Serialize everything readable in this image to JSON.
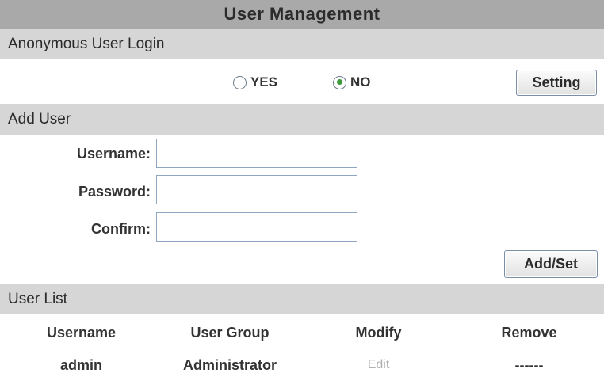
{
  "title": "User Management",
  "sections": {
    "anonymous": "Anonymous User Login",
    "add_user": "Add User",
    "user_list": "User List"
  },
  "anonymous_login": {
    "options": [
      "YES",
      "NO"
    ],
    "selected": "NO",
    "setting_button": "Setting"
  },
  "add_user_form": {
    "username_label": "Username:",
    "password_label": "Password:",
    "confirm_label": "Confirm:",
    "username_value": "",
    "password_value": "",
    "confirm_value": "",
    "add_set_button": "Add/Set"
  },
  "user_table": {
    "columns": [
      "Username",
      "User Group",
      "Modify",
      "Remove"
    ],
    "rows": [
      [
        "admin",
        "Administrator",
        "Edit",
        "------"
      ]
    ]
  }
}
